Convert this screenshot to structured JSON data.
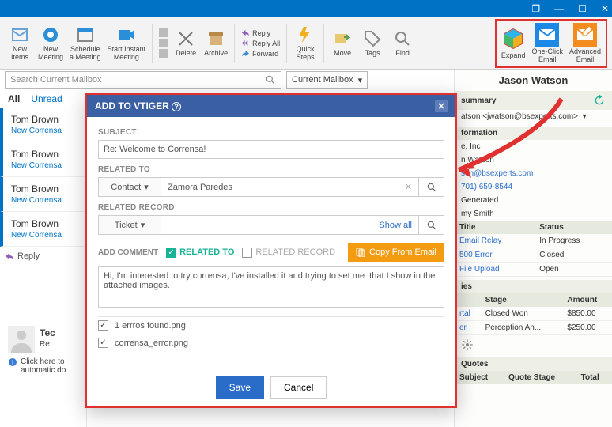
{
  "titlebar": {
    "restore": "❐",
    "minimize": "—",
    "maximize": "☐",
    "close": "✕"
  },
  "ribbon": {
    "new_items": "New\nItems",
    "new_meeting": "New\nMeeting",
    "schedule": "Schedule\na Meeting",
    "instant": "Start Instant\nMeeting",
    "delete": "Delete",
    "archive": "Archive",
    "reply": "Reply",
    "reply_all": "Reply All",
    "forward": "Forward",
    "quick_steps": "Quick\nSteps",
    "move": "Move",
    "tags": "Tags",
    "find": "Find",
    "expand": "Expand",
    "oneclick": "One-Click\nEmail",
    "advanced": "Advanced\nEmail"
  },
  "search": {
    "placeholder": "Search Current Mailbox",
    "scope": "Current Mailbox"
  },
  "filters": {
    "all": "All",
    "unread": "Unread"
  },
  "mail": [
    {
      "from": "Tom Brown",
      "preview": "New Corrensa"
    },
    {
      "from": "Tom Brown",
      "preview": "New Corrensa"
    },
    {
      "from": "Tom Brown",
      "preview": "New Corrensa"
    },
    {
      "from": "Tom Brown",
      "preview": "New Corrensa"
    }
  ],
  "reply_label": "Reply",
  "reading": {
    "tec": "Tec",
    "re": "Re:",
    "autodl": "Click here to\nautomatic do"
  },
  "panel": {
    "name": "Jason Watson",
    "summary_label": "summary",
    "email": "atson <jwatson@bsexperts.com>",
    "info_label": "formation",
    "company_suffix": "e, Inc",
    "contact_name": "n Watson",
    "contact_email": "son@bsexperts.com",
    "phone": "701) 659-8544",
    "source": "Generated",
    "owner": "my Smith",
    "tickets": {
      "cols": [
        "Title",
        "Status"
      ],
      "rows": [
        [
          "Email Relay",
          "In Progress"
        ],
        [
          "500 Error",
          "Closed"
        ],
        [
          "File Upload",
          "Open"
        ]
      ]
    },
    "opps_label": "ies",
    "opps": {
      "cols": [
        "Stage",
        "Amount"
      ],
      "rows": [
        [
          "rtal",
          "Closed Won",
          "$850.00"
        ],
        [
          "er",
          "Perception An...",
          "$250.00"
        ]
      ]
    },
    "quotes_label": "Quotes",
    "quotes_cols": [
      "Subject",
      "Quote Stage",
      "Total"
    ]
  },
  "modal": {
    "title": "ADD TO VTIGER",
    "subject_label": "SUBJECT",
    "subject": "Re: Welcome to Corrensa!",
    "related_to_label": "RELATED TO",
    "related_type": "Contact",
    "related_value": "Zamora Paredes",
    "related_record_label": "RELATED RECORD",
    "record_type": "Ticket",
    "show_all": "Show all",
    "add_comment_label": "ADD COMMENT",
    "chk_related_to": "RELATED TO",
    "chk_related_record": "RELATED RECORD",
    "copy_btn": "Copy From Email",
    "comment": "Hi, I'm interested to try corrensa, I've installed it and trying to set me  that I show in the attached images.",
    "attachments": [
      "1 errros found.png",
      "corrensa_error.png"
    ],
    "save": "Save",
    "cancel": "Cancel"
  }
}
